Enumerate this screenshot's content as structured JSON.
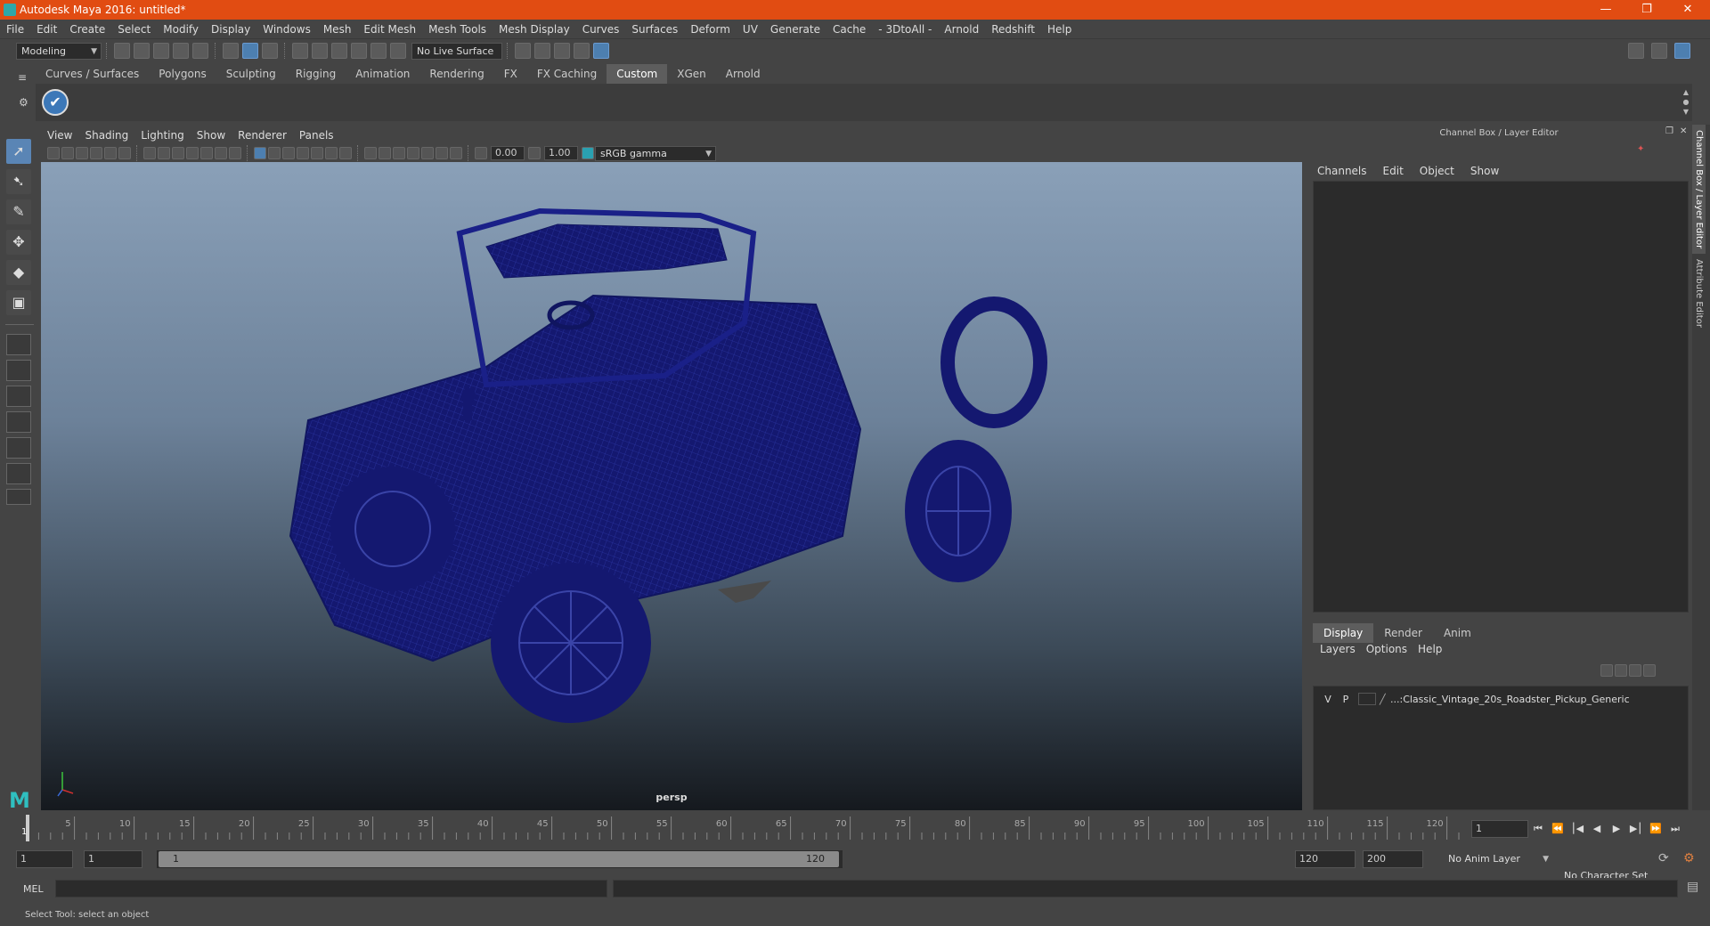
{
  "window": {
    "title": "Autodesk Maya 2016: untitled*",
    "minimize": "—",
    "restore": "❐",
    "close": "✕"
  },
  "menubar": [
    "File",
    "Edit",
    "Create",
    "Select",
    "Modify",
    "Display",
    "Windows",
    "Mesh",
    "Edit Mesh",
    "Mesh Tools",
    "Mesh Display",
    "Curves",
    "Surfaces",
    "Deform",
    "UV",
    "Generate",
    "Cache",
    "- 3DtoAll -",
    "Arnold",
    "Redshift",
    "Help"
  ],
  "statusline": {
    "menuset": "Modeling",
    "live_surface": "No Live Surface"
  },
  "shelf": {
    "tabs": [
      "Curves / Surfaces",
      "Polygons",
      "Sculpting",
      "Rigging",
      "Animation",
      "Rendering",
      "FX",
      "FX Caching",
      "Custom",
      "XGen",
      "Arnold"
    ],
    "active_tab": "Custom"
  },
  "viewport": {
    "menus": [
      "View",
      "Shading",
      "Lighting",
      "Show",
      "Renderer",
      "Panels"
    ],
    "exposure": "0.00",
    "gamma": "1.00",
    "color_space": "sRGB gamma",
    "camera_label": "persp",
    "wire_color": "#141870"
  },
  "channel_box": {
    "header": "Channel Box / Layer Editor",
    "menus": [
      "Channels",
      "Edit",
      "Object",
      "Show"
    ]
  },
  "layer_editor": {
    "tabs": [
      "Display",
      "Render",
      "Anim"
    ],
    "active_tab": "Display",
    "menus": [
      "Layers",
      "Options",
      "Help"
    ],
    "layers": [
      {
        "v": "V",
        "p": "P",
        "name": "...:Classic_Vintage_20s_Roadster_Pickup_Generic"
      }
    ]
  },
  "side_tabs": [
    "Channel Box / Layer Editor",
    "Attribute Editor"
  ],
  "time_slider": {
    "ticks": [
      "5",
      "10",
      "15",
      "20",
      "25",
      "30",
      "35",
      "40",
      "45",
      "50",
      "55",
      "60",
      "65",
      "70",
      "75",
      "80",
      "85",
      "90",
      "95",
      "100",
      "105",
      "110",
      "115",
      "120"
    ],
    "start_marker": "1",
    "current_frame": "1"
  },
  "range": {
    "start": "1",
    "playback_start": "1",
    "slider_start": "1",
    "slider_end": "120",
    "playback_end": "120",
    "end": "200",
    "anim_layer": "No Anim Layer",
    "character_set": "No Character Set"
  },
  "command_line": {
    "label": "MEL"
  },
  "help_line": {
    "text": "Select Tool: select an object"
  }
}
